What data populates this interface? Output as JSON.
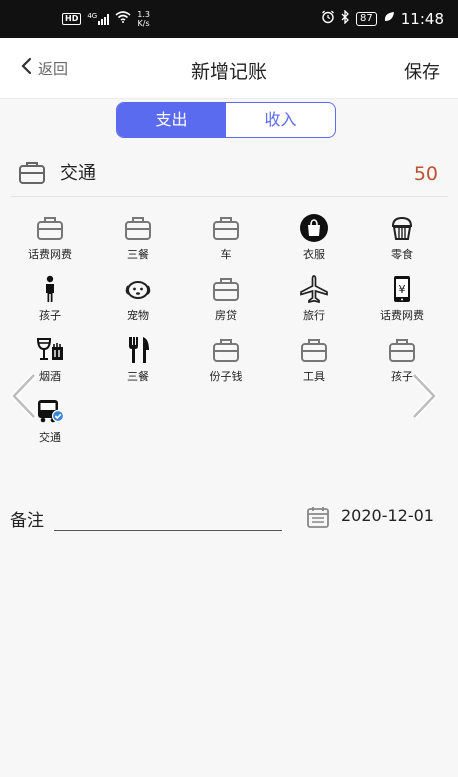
{
  "status_bar": {
    "hd": "HD",
    "net_type": "4G",
    "speed_value": "1.3",
    "speed_unit": "K/s",
    "battery": "87",
    "time": "11:48"
  },
  "header": {
    "back_label": "返回",
    "title": "新增记账",
    "save_label": "保存"
  },
  "tabs": {
    "expense": "支出",
    "income": "收入"
  },
  "selected": {
    "category": "交通",
    "amount": "50"
  },
  "categories": [
    {
      "label": "话费网费",
      "icon": "briefcase-icon"
    },
    {
      "label": "三餐",
      "icon": "briefcase-icon"
    },
    {
      "label": "车",
      "icon": "briefcase-icon"
    },
    {
      "label": "衣服",
      "icon": "shopping-bag-icon"
    },
    {
      "label": "零食",
      "icon": "cupcake-icon"
    },
    {
      "label": "孩子",
      "icon": "child-icon"
    },
    {
      "label": "宠物",
      "icon": "dog-icon"
    },
    {
      "label": "房贷",
      "icon": "briefcase-icon"
    },
    {
      "label": "旅行",
      "icon": "airplane-icon"
    },
    {
      "label": "话费网费",
      "icon": "phone-yuan-icon"
    },
    {
      "label": "烟酒",
      "icon": "wine-glass-icon"
    },
    {
      "label": "三餐",
      "icon": "fork-knife-icon"
    },
    {
      "label": "份子钱",
      "icon": "briefcase-icon"
    },
    {
      "label": "工具",
      "icon": "briefcase-icon"
    },
    {
      "label": "孩子",
      "icon": "briefcase-icon"
    },
    {
      "label": "交通",
      "icon": "bus-icon"
    }
  ],
  "note": {
    "label": "备注",
    "value": ""
  },
  "date": "2020-12-01",
  "colors": {
    "accent": "#5b6bf0",
    "amount": "#c0502f"
  }
}
